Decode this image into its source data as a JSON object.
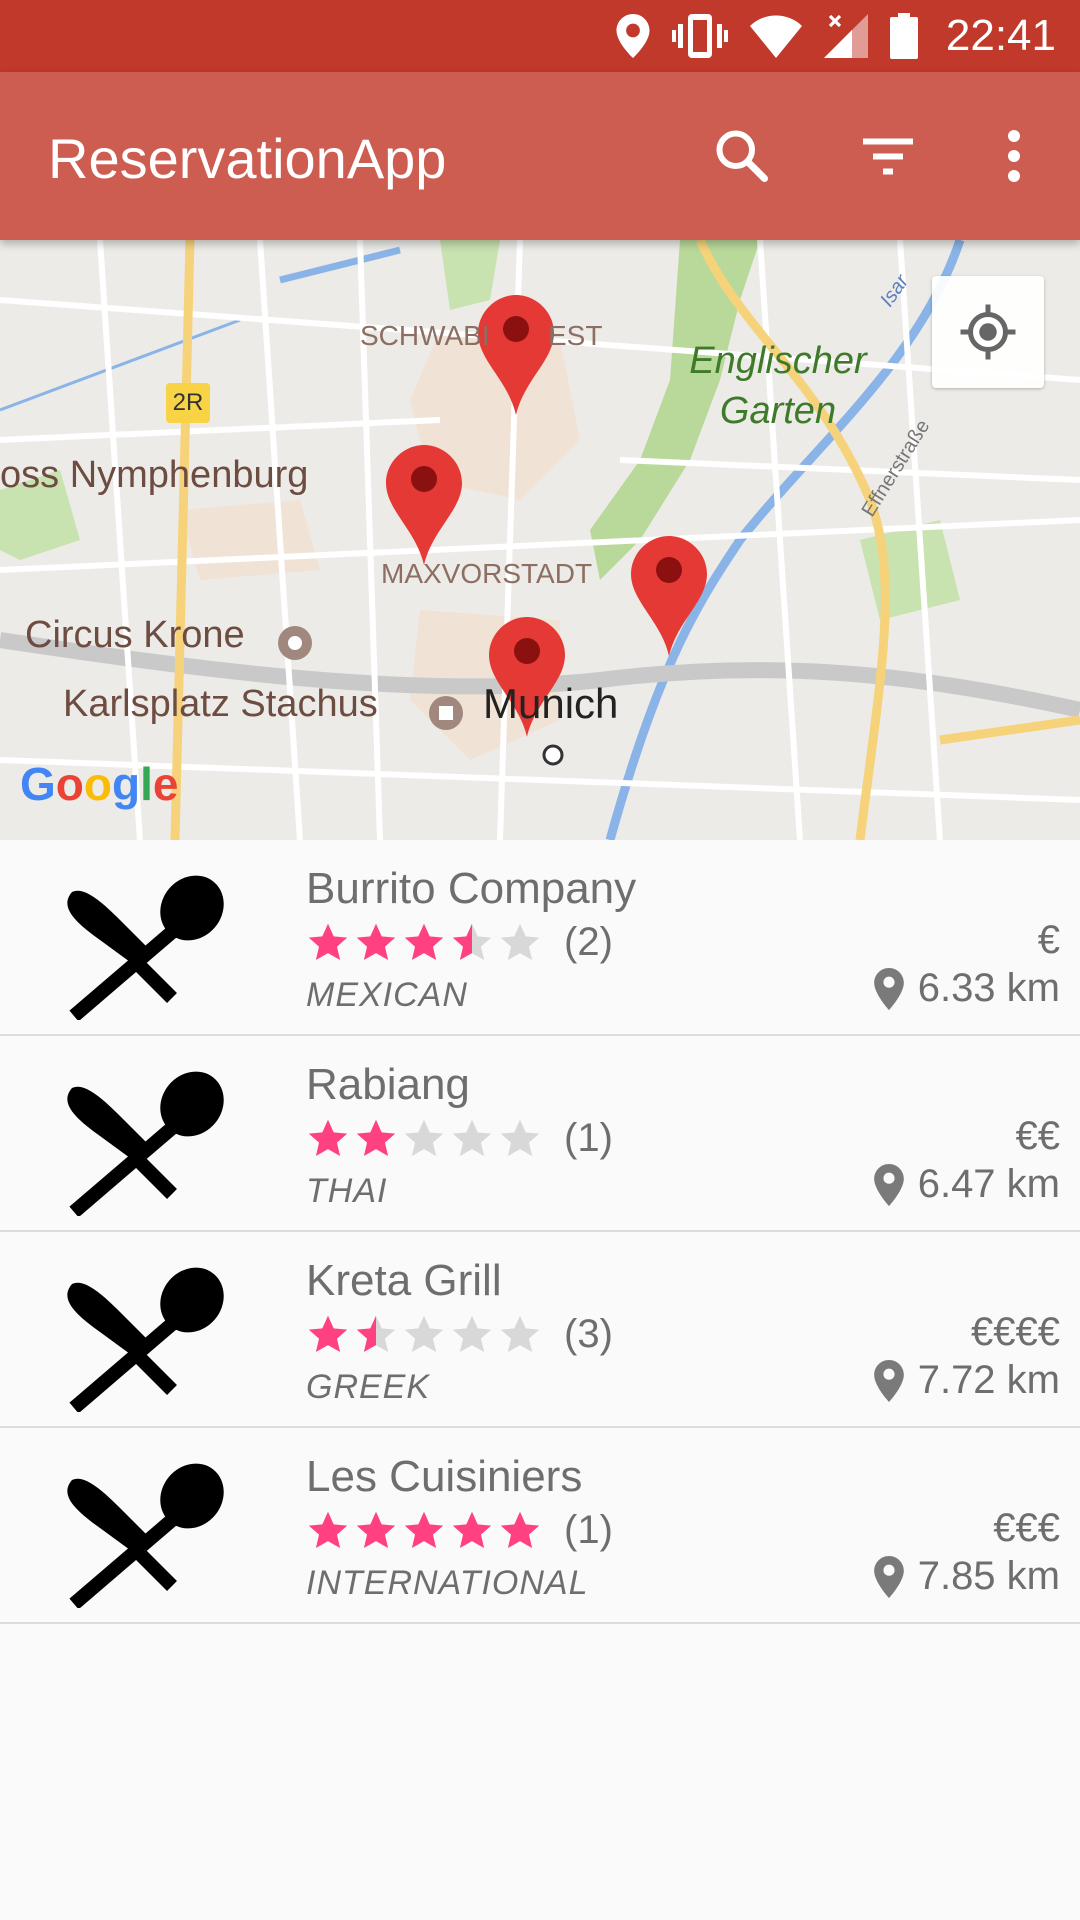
{
  "status_bar": {
    "time": "22:41",
    "icons": [
      "location-icon",
      "vibrate-icon",
      "wifi-icon",
      "signal-icon",
      "battery-icon"
    ]
  },
  "app_bar": {
    "title": "ReservationApp",
    "actions": [
      "search-icon",
      "filter-icon",
      "more-vert-icon"
    ]
  },
  "map": {
    "labels": {
      "schwabing": "SCHWABI",
      "schwabing_tail": "EST",
      "englischer_line1": "Englischer",
      "englischer_line2": "Garten",
      "nymphenburg": "oss Nymphenburg",
      "maxvorstadt": "MAXVORSTADT",
      "circus_krone": "Circus Krone",
      "karlsplatz": "Karlsplatz Stachus",
      "munich": "Munich",
      "isar": "Isar",
      "effnerstrasse": "Effnerstraße",
      "road_badge": "2R",
      "google": "Google"
    },
    "markers": [
      "restaurant-marker",
      "restaurant-marker",
      "restaurant-marker",
      "restaurant-marker"
    ],
    "my_location_button": "my-location-icon"
  },
  "restaurants": [
    {
      "name": "Burrito Company",
      "rating": 3.5,
      "reviews": "(2)",
      "category": "MEXICAN",
      "price": "€",
      "distance": "6.33 km"
    },
    {
      "name": "Rabiang",
      "rating": 2,
      "reviews": "(1)",
      "category": "THAI",
      "price": "€€",
      "distance": "6.47 km"
    },
    {
      "name": "Kreta Grill",
      "rating": 1.5,
      "reviews": "(3)",
      "category": "GREEK",
      "price": "€€€€",
      "distance": "7.72 km"
    },
    {
      "name": "Les Cuisiniers",
      "rating": 5,
      "reviews": "(1)",
      "category": "INTERNATIONAL",
      "price": "€€€",
      "distance": "7.85 km"
    }
  ],
  "colors": {
    "status_bar": "#c0392b",
    "app_bar": "#cd5c51",
    "star_filled": "#ff4081",
    "star_empty": "#d8d8d8",
    "marker": "#e53935"
  }
}
